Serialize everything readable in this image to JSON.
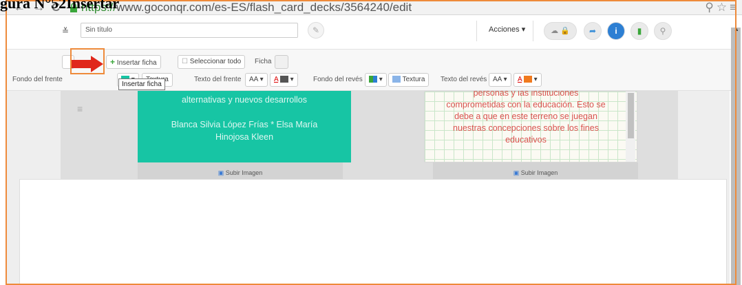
{
  "caption": "gura N°52Insertar",
  "browser": {
    "url_scheme": "https://",
    "url_rest": "www.goconqr.com/es-ES/flash_card_decks/3564240/edit",
    "back_icon": "back-arrow-icon",
    "forward_icon": "forward-arrow-icon",
    "reload_icon": "reload-icon",
    "right_icons": "zoom-icon star-icon menu-icon"
  },
  "header": {
    "title_value": "Sin título",
    "actions_label": "Acciones ▾",
    "share_glyph": "➦",
    "info_glyph": "i",
    "book_glyph": "▮",
    "search_glyph": "⚲"
  },
  "toolbar": {
    "insert_card": "Insertar ficha",
    "select_all": "Seleccionar todo",
    "card_label": "Ficha",
    "front_bg": "Fondo del frente",
    "texture": "Textura",
    "front_text": "Texto del frente",
    "back_bg": "Fondo del revés",
    "back_text": "Texto del revés",
    "font_glyph": "AA ▾",
    "color_glyph": "A",
    "tooltip": "Insertar ficha"
  },
  "cards": [
    {
      "front_lines": [
        "alternativas y nuevos desarrollos",
        "",
        "Blanca Silvia López Frías * Elsa María",
        "Hinojosa Kleen"
      ],
      "back_lines": [
        "personas y las instituciones",
        "comprometidas con la educación. Esto se",
        "debe a que en este terreno se juegan",
        "nuestras concepciones sobre los fines",
        "educativos"
      ],
      "upload_front": "Subir Imagen",
      "upload_back": "Subir Imagen"
    },
    {
      "front_lines": [],
      "back_lines": []
    }
  ],
  "colors": {
    "accent_teal": "#17c5a4",
    "highlight_orange": "#ee8a3a",
    "arrow_red": "#e0271b",
    "back_text_red": "#d9534f",
    "plus_green": "#3aa63a"
  }
}
